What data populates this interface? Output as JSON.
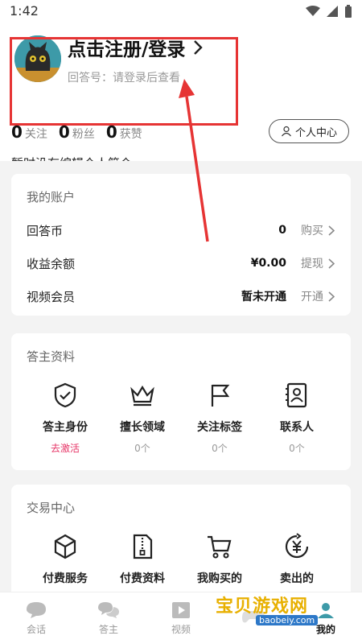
{
  "status_bar": {
    "time": "1:42"
  },
  "profile": {
    "login_title": "点击注册/登录",
    "login_sub": "回答号：请登录后查看",
    "stats": [
      {
        "num": "0",
        "label": "关注"
      },
      {
        "num": "0",
        "label": "粉丝"
      },
      {
        "num": "0",
        "label": "获赞"
      }
    ],
    "center_button": "个人中心",
    "intro": "暂时没有编辑个人简介~"
  },
  "account": {
    "title": "我的账户",
    "rows": [
      {
        "label": "回答币",
        "value": "0",
        "action": "购买"
      },
      {
        "label": "收益余额",
        "value": "¥0.00",
        "action": "提现"
      },
      {
        "label": "视频会员",
        "value": "暂未开通",
        "action": "开通"
      }
    ]
  },
  "answerer": {
    "title": "答主资料",
    "items": [
      {
        "label": "答主身份",
        "sub": "去激活",
        "icon": "shield-check-icon"
      },
      {
        "label": "擅长领域",
        "sub": "0个",
        "icon": "crown-icon"
      },
      {
        "label": "关注标签",
        "sub": "0个",
        "icon": "flag-icon"
      },
      {
        "label": "联系人",
        "sub": "0个",
        "icon": "contact-book-icon"
      }
    ]
  },
  "trade": {
    "title": "交易中心",
    "items": [
      {
        "label": "付费服务",
        "icon": "box-icon"
      },
      {
        "label": "付费资料",
        "icon": "zip-file-icon"
      },
      {
        "label": "我购买的",
        "icon": "cart-icon"
      },
      {
        "label": "卖出的",
        "icon": "yen-cycle-icon"
      }
    ]
  },
  "bottom_nav": [
    {
      "label": "会话",
      "icon": "chat-bubble-icon"
    },
    {
      "label": "答主",
      "icon": "double-chat-icon"
    },
    {
      "label": "视频",
      "icon": "video-icon"
    },
    {
      "label": "",
      "icon": "gamepad-icon"
    },
    {
      "label": "我的",
      "icon": "user-icon"
    }
  ],
  "watermark": {
    "text": "宝贝游戏网",
    "url": "baobeiy.com"
  },
  "colors": {
    "highlight": "#e63434",
    "activate": "#e63466",
    "brand_green": "#3d9aa8"
  }
}
